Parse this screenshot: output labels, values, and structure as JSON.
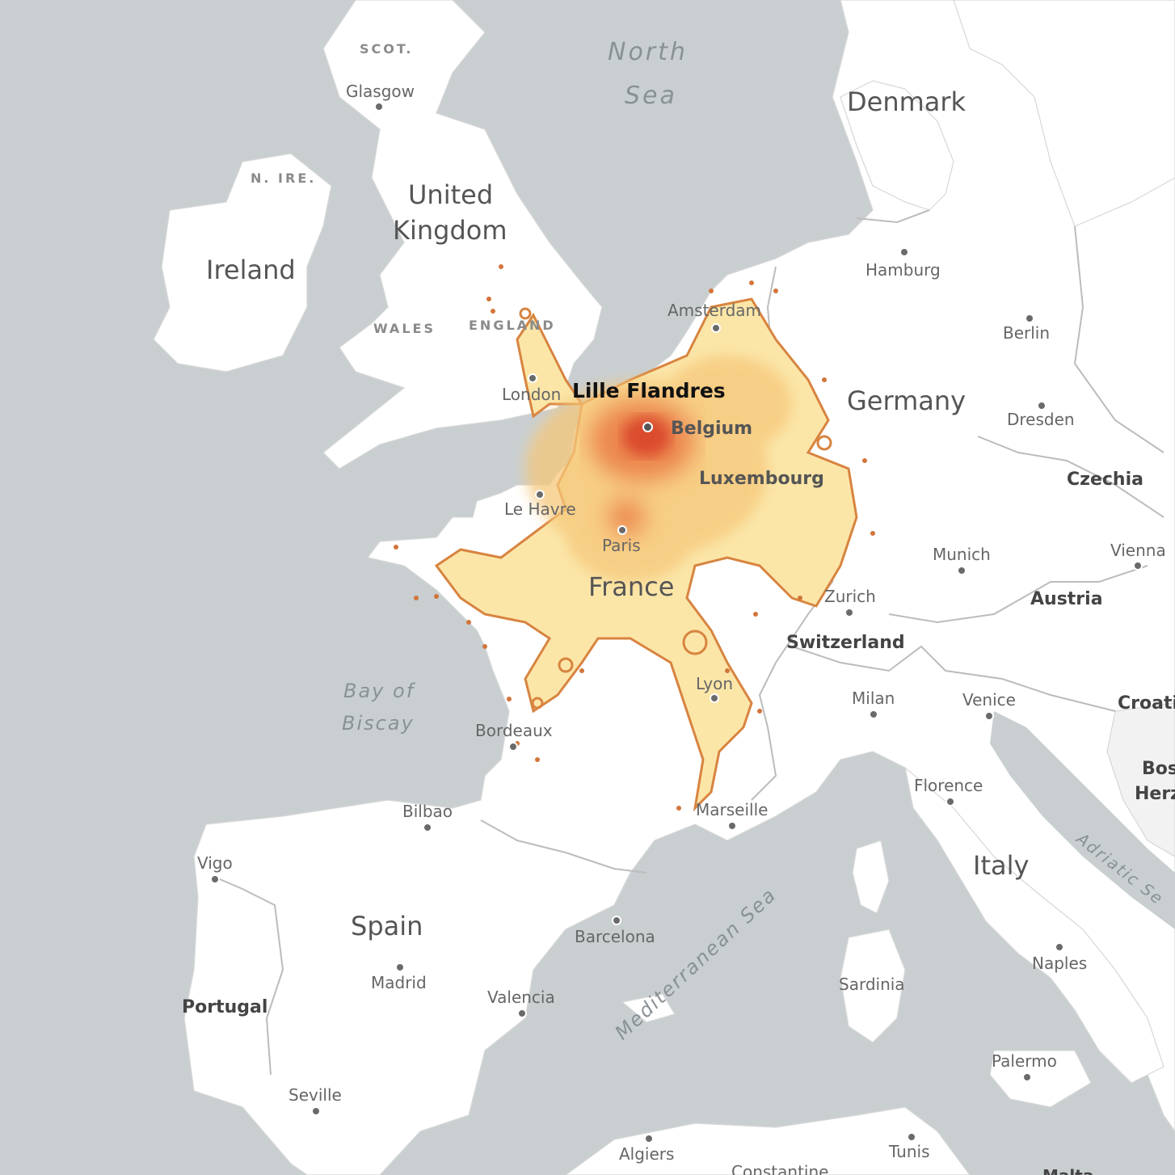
{
  "origin_station": "Lille Flandres",
  "countries": {
    "ireland": "Ireland",
    "uk_line1": "United",
    "uk_line2": "Kingdom",
    "denmark": "Denmark",
    "germany": "Germany",
    "belgium": "Belgium",
    "luxembourg": "Luxembourg",
    "france": "France",
    "czechia": "Czechia",
    "austria": "Austria",
    "switzerland": "Switzerland",
    "croatia": "Croatia",
    "bosnia_line1": "Bos",
    "bosnia_line2": "Herz",
    "italy": "Italy",
    "spain": "Spain",
    "portugal": "Portugal"
  },
  "regions": {
    "scot": "SCOT.",
    "n_ire": "N. IRE.",
    "wales": "WALES",
    "england": "ENGLAND"
  },
  "seas": {
    "north_sea_line1": "North",
    "north_sea_line2": "Sea",
    "biscay_line1": "Bay of",
    "biscay_line2": "Biscay",
    "mediterranean": "Mediterranean Sea",
    "adriatic": "Adriatic Se"
  },
  "cities": {
    "glasgow": "Glasgow",
    "london": "London",
    "amsterdam": "Amsterdam",
    "hamburg": "Hamburg",
    "berlin": "Berlin",
    "dresden": "Dresden",
    "le_havre": "Le Havre",
    "paris": "Paris",
    "munich": "Munich",
    "vienna": "Vienna",
    "zurich": "Zurich",
    "milan": "Milan",
    "venice": "Venice",
    "lyon": "Lyon",
    "bordeaux": "Bordeaux",
    "florence": "Florence",
    "marseille": "Marseille",
    "bilbao": "Bilbao",
    "vigo": "Vigo",
    "madrid": "Madrid",
    "barcelona": "Barcelona",
    "valencia": "Valencia",
    "sardinia": "Sardinia",
    "naples": "Naples",
    "palermo": "Palermo",
    "seville": "Seville",
    "algiers": "Algiers",
    "tunis": "Tunis",
    "constantine": "Constantine",
    "malta": "Malta"
  },
  "colors": {
    "water": "#c9cfd1",
    "land": "#ffffff",
    "isochrone_near": "#d9442a",
    "isochrone_mid": "#f0a060",
    "isochrone_far": "#fbe3a0",
    "isochrone_edge": "#d88440"
  }
}
